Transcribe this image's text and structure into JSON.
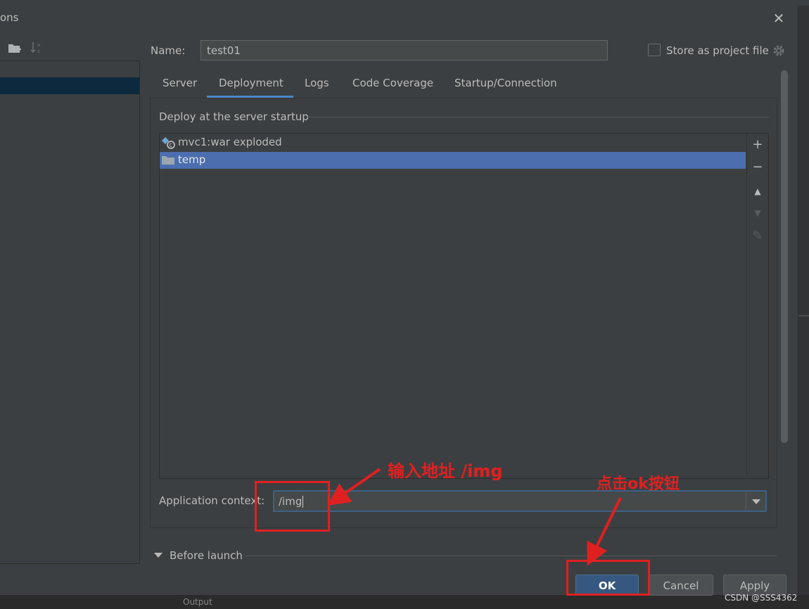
{
  "dialog": {
    "title": "ons",
    "close_label": "✕"
  },
  "name_row": {
    "label": "Name:",
    "value": "test01",
    "store_label": "Store as project file"
  },
  "tabs": [
    {
      "label": "Server"
    },
    {
      "label": "Deployment"
    },
    {
      "label": "Logs"
    },
    {
      "label": "Code Coverage"
    },
    {
      "label": "Startup/Connection"
    }
  ],
  "deployment": {
    "section_label": "Deploy at the server startup",
    "items": [
      {
        "label": "mvc1:war exploded",
        "icon": "artifact-icon"
      },
      {
        "label": "temp",
        "icon": "folder-icon"
      }
    ],
    "toolbar": {
      "add": "+",
      "remove": "−",
      "up": "▲",
      "down": "▼",
      "edit": "✎"
    }
  },
  "app_context": {
    "label": "Application context:",
    "value": "/img"
  },
  "before_launch": {
    "label": "Before launch"
  },
  "buttons": {
    "ok": "OK",
    "cancel": "Cancel",
    "apply": "Apply"
  },
  "annotations": {
    "enter_address": "输入地址 /img",
    "click_ok": "点击ok按钮",
    "color": "#e02020"
  },
  "bottom": {
    "output_label": "Output"
  },
  "watermark": "CSDN @SSS4362",
  "colors": {
    "selection": "#4b6eaf",
    "ok_button": "#365880",
    "tab_underline": "#4a88c7",
    "annotation": "#e02020"
  }
}
